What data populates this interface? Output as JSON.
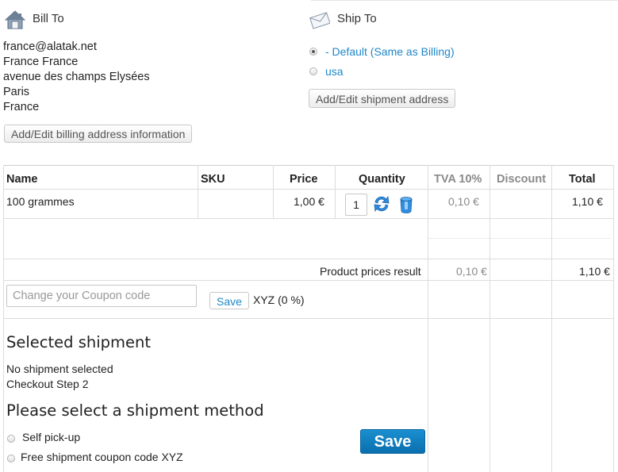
{
  "bill_to": {
    "title": "Bill To",
    "email": "france@alatak.net",
    "name": "France France",
    "street": "avenue des champs Elysées",
    "city": "Paris",
    "country": "France",
    "edit_button": "Add/Edit billing address information"
  },
  "ship_to": {
    "title": "Ship To",
    "options": [
      {
        "label": "- Default (Same as Billing)",
        "checked": true
      },
      {
        "label": "usa",
        "checked": false
      }
    ],
    "edit_button": "Add/Edit shipment address"
  },
  "cart_table": {
    "headers": {
      "name": "Name",
      "sku": "SKU",
      "price": "Price",
      "quantity": "Quantity",
      "tax": "TVA 10%",
      "discount": "Discount",
      "total": "Total"
    },
    "rows": [
      {
        "name": "100 grammes",
        "sku": "",
        "price": "1,00 €",
        "quantity": "1",
        "tax": "0,10 €",
        "discount": "",
        "total": "1,10 €"
      }
    ],
    "result_label": "Product prices result",
    "result_tax": "0,10 €",
    "result_total": "1,10 €"
  },
  "coupon": {
    "placeholder": "Change your Coupon code",
    "save_label": "Save",
    "applied": "XYZ (0 %)"
  },
  "shipment": {
    "selected_title": "Selected shipment",
    "status": "No shipment selected",
    "step": "Checkout Step 2",
    "select_title": "Please select a shipment method",
    "methods": [
      {
        "label": "Self pick-up"
      },
      {
        "label": "Free shipment coupon code XYZ"
      }
    ],
    "save_label": "Save"
  }
}
